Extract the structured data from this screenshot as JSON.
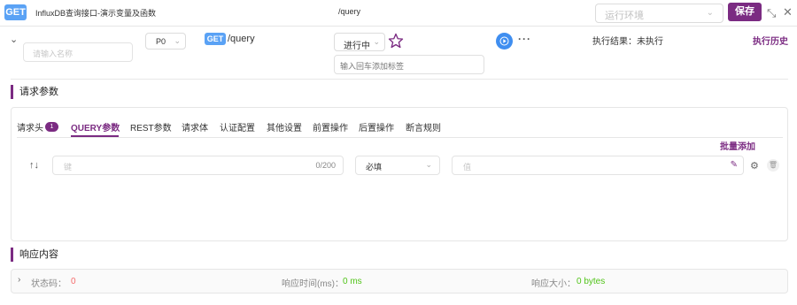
{
  "topbar": {
    "method": "GET",
    "title": "InfluxDB查询接口-演示变量及函数",
    "path": "/query",
    "env_placeholder": "运行环境",
    "save_label": "保存"
  },
  "request": {
    "name_placeholder": "请输入名称",
    "priority": "P0",
    "method": "GET",
    "path": "/query",
    "status": "进行中",
    "tag_placeholder": "输入回车添加标签",
    "exec_result": "执行结果：未执行",
    "history_label": "执行历史"
  },
  "params": {
    "section_title": "请求参数",
    "tabs": [
      {
        "label": "请求头"
      },
      {
        "label": "QUERY参数"
      },
      {
        "label": "REST参数"
      },
      {
        "label": "请求体"
      },
      {
        "label": "认证配置"
      },
      {
        "label": "其他设置"
      },
      {
        "label": "前置操作"
      },
      {
        "label": "后置操作"
      },
      {
        "label": "断言规则"
      }
    ],
    "header_badge": "1",
    "bulk_add_label": "批量添加",
    "row": {
      "key_placeholder": "键",
      "key_count": "0/200",
      "required": "必填",
      "value_placeholder": "值"
    }
  },
  "response": {
    "section_title": "响应内容",
    "status_label": "状态码：",
    "status_value": "0",
    "time_label": "响应时间(ms)：",
    "time_value": "0 ms",
    "size_label": "响应大小：",
    "size_value": "0 bytes"
  },
  "colors": {
    "accent": "#7b2b82",
    "method_blue": "#5aa2f5",
    "run_blue": "#3f8ef0",
    "status_red": "#f56c6c",
    "value_green": "#52c41a"
  }
}
